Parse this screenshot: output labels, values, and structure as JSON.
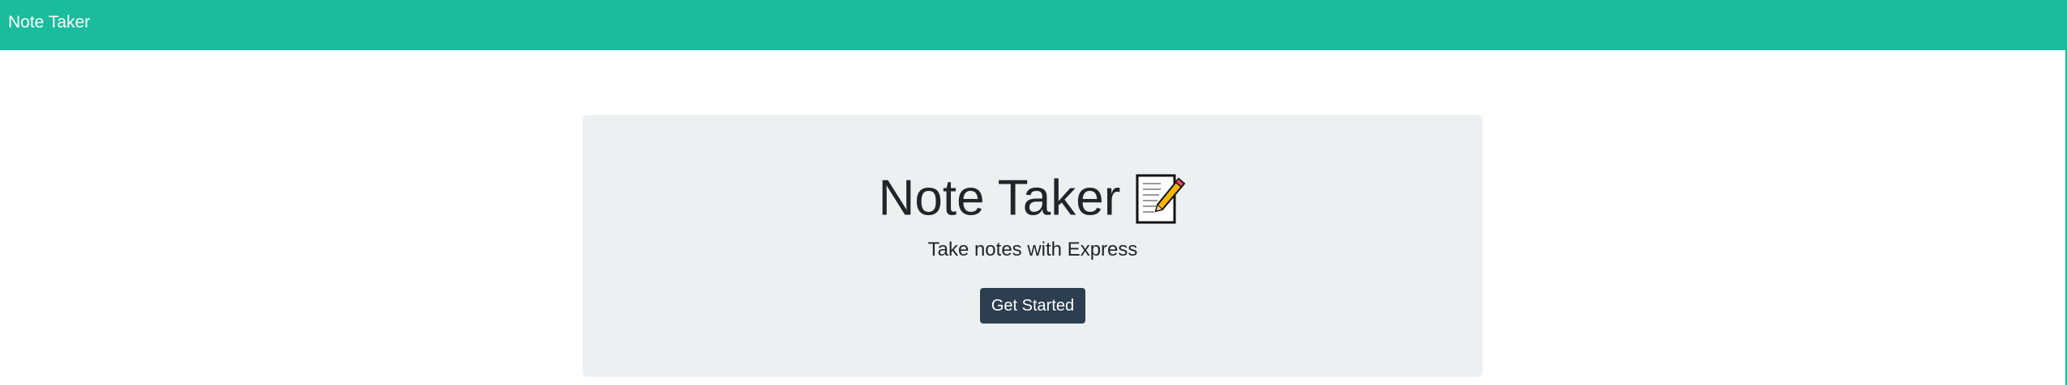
{
  "navbar": {
    "brand": "Note Taker"
  },
  "hero": {
    "title": "Note Taker",
    "icon": "memo-icon",
    "subtitle": "Take notes with Express",
    "button_label": "Get Started"
  },
  "colors": {
    "navbar": "#1abc9c",
    "hero_background": "#ecf0f1",
    "button": "#2c3e50",
    "text": "#212529"
  }
}
